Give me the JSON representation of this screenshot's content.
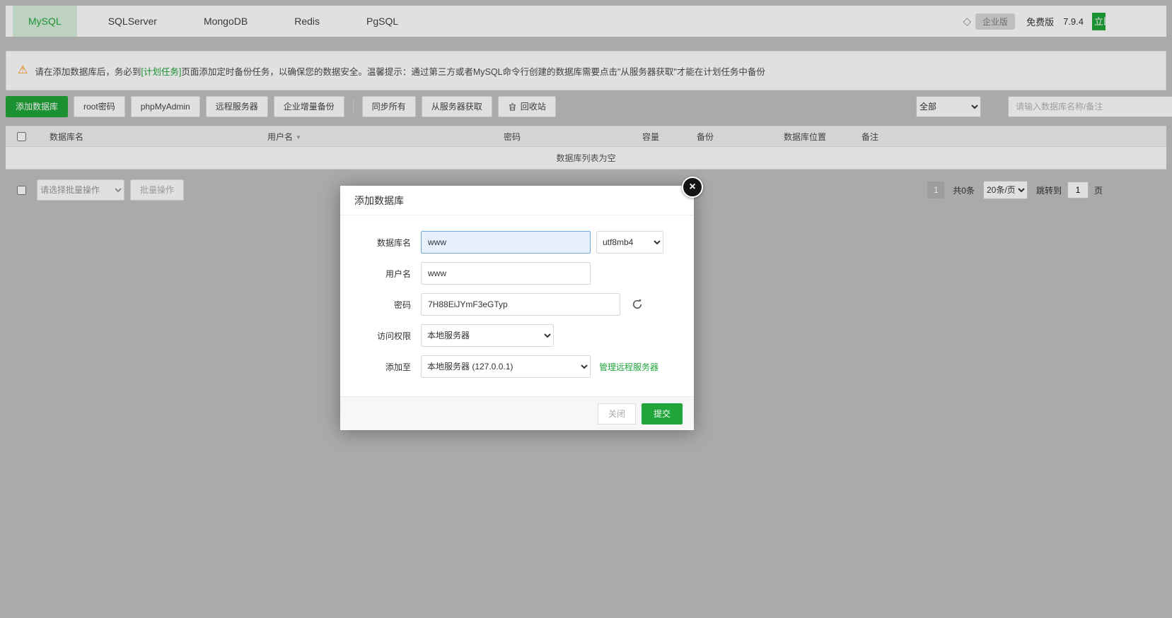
{
  "tabbar": {
    "tabs": [
      {
        "label": "MySQL"
      },
      {
        "label": "SQLServer"
      },
      {
        "label": "MongoDB"
      },
      {
        "label": "Redis"
      },
      {
        "label": "PgSQL"
      }
    ],
    "plan_badge": "企业版",
    "edition": "免费版",
    "version": "7.9.4",
    "upgrade_label": "立即升级"
  },
  "notice": {
    "text_before": "请在添加数据库后，务必到",
    "link_text": "[计划任务]",
    "text_after": "页面添加定时备份任务，以确保您的数据安全。温馨提示：通过第三方或者MySQL命令行创建的数据库需要点击\"从服务器获取\"才能在计划任务中备份"
  },
  "toolbar": {
    "add_db": "添加数据库",
    "root_pwd": "root密码",
    "phpmyadmin": "phpMyAdmin",
    "remote_server": "远程服务器",
    "ent_backup": "企业增量备份",
    "sync_all": "同步所有",
    "fetch_from_server": "从服务器获取",
    "recycle_bin": "回收站",
    "filter_selected": "全部",
    "search_placeholder": "请输入数据库名称/备注"
  },
  "table": {
    "headers": [
      "数据库名",
      "用户名",
      "密码",
      "容量",
      "备份",
      "数据库位置",
      "备注"
    ],
    "empty_text": "数据库列表为空"
  },
  "batchbar": {
    "batch_select": "请选择批量操作",
    "batch_button": "批量操作"
  },
  "pagination": {
    "current_page": "1",
    "total": "共0条",
    "page_size": "20条/页",
    "jump_label": "跳转到",
    "jump_value": "1",
    "page_unit": "页"
  },
  "modal": {
    "title": "添加数据库",
    "db_name": {
      "label": "数据库名",
      "value": "www"
    },
    "charset": {
      "value": "utf8mb4"
    },
    "username": {
      "label": "用户名",
      "value": "www"
    },
    "password": {
      "label": "密码",
      "value": "7H88EiJYmF3eGTyp"
    },
    "access": {
      "label": "访问权限",
      "value": "本地服务器"
    },
    "target": {
      "label": "添加至",
      "value": "本地服务器 (127.0.0.1)"
    },
    "manage_remote": "管理远程服务器",
    "close_button": "关闭",
    "submit_button": "提交"
  },
  "icons": {
    "close": "×",
    "warning": "⚠",
    "diamond": "◇",
    "sort_caret": "▼"
  },
  "colors": {
    "primary_green": "#20a53a",
    "active_tab_bg": "#d9efdd",
    "warning_orange": "#ff9102",
    "focus_input_bg": "#e8f0fe",
    "focus_input_border": "#6ea8dd"
  }
}
